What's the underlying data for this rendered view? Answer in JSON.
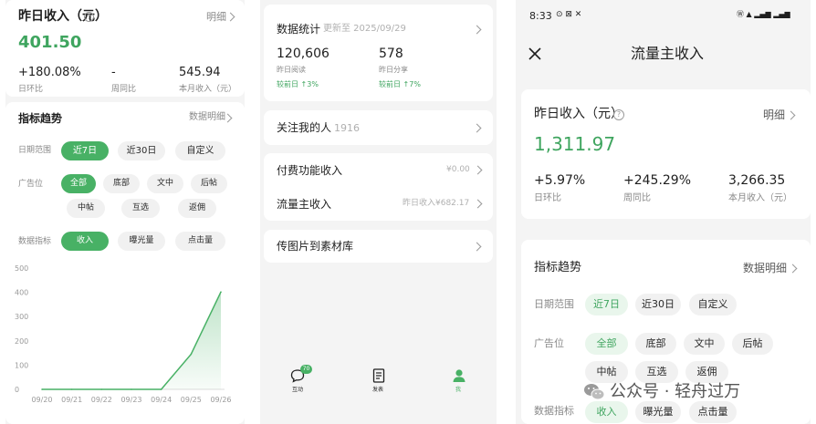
{
  "left": {
    "yesterday_title": "昨日收入（元）",
    "detail": "明细",
    "yesterday_value": "401.50",
    "stats": [
      {
        "value": "+180.08%",
        "label": "日环比"
      },
      {
        "value": "-",
        "label": "周同比"
      },
      {
        "value": "545.94",
        "label": "本月收入（元）"
      }
    ],
    "trend_title": "指标趋势",
    "trend_detail": "数据明细",
    "date_label": "日期范围",
    "date_opts": [
      "近7日",
      "近30日",
      "自定义"
    ],
    "ad_label": "广告位",
    "ad_opts": [
      "全部",
      "底部",
      "文中",
      "后帖",
      "中帖",
      "互选",
      "返佣"
    ],
    "metric_label": "数据指标",
    "metric_opts": [
      "收入",
      "曝光量",
      "点击量"
    ]
  },
  "chart_data": {
    "type": "area",
    "x": [
      "09/20",
      "09/21",
      "09/22",
      "09/23",
      "09/24",
      "09/25",
      "09/26"
    ],
    "values": [
      0,
      0,
      0,
      0,
      0,
      145,
      401.5
    ],
    "ylim": [
      0,
      500
    ],
    "yticks": [
      "500",
      "400",
      "300",
      "200",
      "100",
      "0"
    ],
    "grid": false,
    "line_color": "#48b165"
  },
  "middle": {
    "stats_title": "数据统计",
    "updated": "更新至 2025/09/29",
    "stats": [
      {
        "value": "120,606",
        "label": "昨日阅读",
        "delta": "较前日 ↑3%"
      },
      {
        "value": "578",
        "label": "昨日分享",
        "delta": "较前日 ↑7%"
      }
    ],
    "follow_label": "关注我的人",
    "follow_count": "1916",
    "paid_label": "付费功能收入",
    "paid_value": "¥0.00",
    "traffic_label": "流量主收入",
    "traffic_value": "昨日收入¥682.17",
    "upload_label": "传图片到素材库",
    "nav": [
      {
        "label": "互动",
        "badge": "70"
      },
      {
        "label": "发表"
      },
      {
        "label": "我"
      }
    ]
  },
  "right": {
    "time": "8:33",
    "status_icons": "⊙ ⊠ ✕",
    "signal": "Ⓦ ▲ ▂▄▆ ▂▄▆",
    "title": "流量主收入",
    "yesterday_title": "昨日收入（元）",
    "detail": "明细",
    "yesterday_value": "1,311.97",
    "stats": [
      {
        "value": "+5.97%",
        "label": "日环比"
      },
      {
        "value": "+245.29%",
        "label": "周同比"
      },
      {
        "value": "3,266.35",
        "label": "本月收入（元）"
      }
    ],
    "trend_title": "指标趋势",
    "trend_detail": "数据明细",
    "date_label": "日期范围",
    "date_opts": [
      "近7日",
      "近30日",
      "自定义"
    ],
    "ad_label": "广告位",
    "ad_opts": [
      "全部",
      "底部",
      "文中",
      "后帖",
      "中帖",
      "互选",
      "返佣"
    ],
    "metric_label": "数据指标",
    "metric_opts": [
      "收入",
      "曝光量",
      "点击量"
    ],
    "watermark": "公众号 · 轻舟过万"
  },
  "colors": {
    "accent": "#48b165",
    "accent_text": "#3fa55f",
    "bg": "#f4f4f4"
  }
}
